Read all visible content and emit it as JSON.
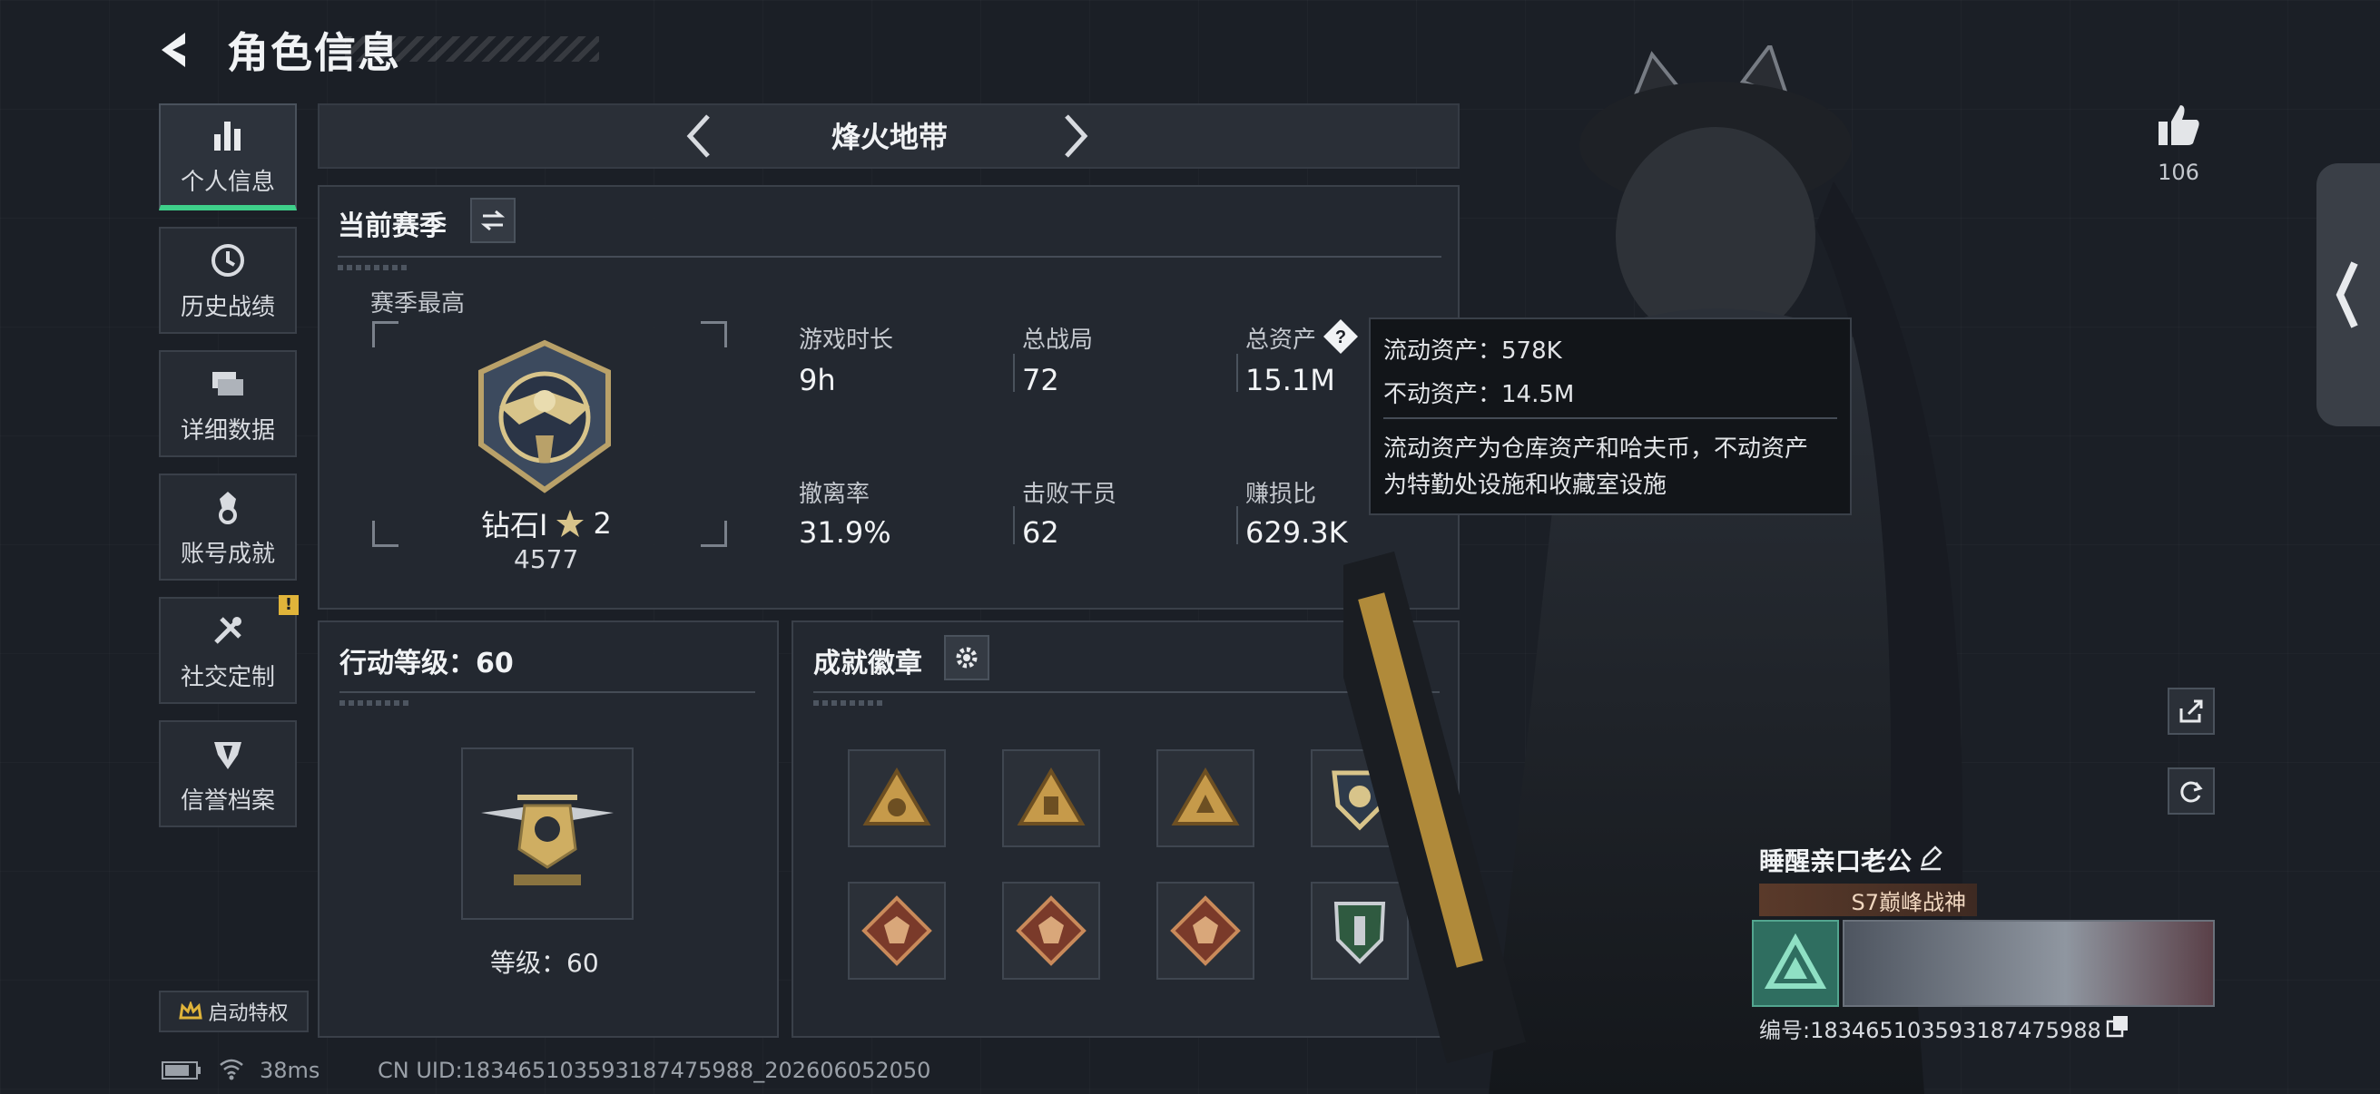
{
  "header": {
    "title": "角色信息"
  },
  "nav": [
    {
      "label": "个人信息",
      "icon": "bar-chart-icon",
      "active": true
    },
    {
      "label": "历史战绩",
      "icon": "clock-icon"
    },
    {
      "label": "详细数据",
      "icon": "layers-icon"
    },
    {
      "label": "账号成就",
      "icon": "medal-icon"
    },
    {
      "label": "社交定制",
      "icon": "tools-icon",
      "badge": "!"
    },
    {
      "label": "信誉档案",
      "icon": "shield-icon"
    }
  ],
  "enable_perk": {
    "label": "启动特权"
  },
  "mode": {
    "title": "烽火地带"
  },
  "season": {
    "title": "当前赛季",
    "best_label": "赛季最高",
    "rank_name": "钻石I",
    "rank_stars": "2",
    "rank_score": "4577",
    "stats": [
      {
        "label": "游戏时长",
        "value": "9h"
      },
      {
        "label": "总战局",
        "value": "72"
      },
      {
        "label": "总资产",
        "value": "15.1M"
      },
      {
        "label": "撤离率",
        "value": "31.9%"
      },
      {
        "label": "击败干员",
        "value": "62"
      },
      {
        "label": "赚损比",
        "value": "629.3K"
      }
    ]
  },
  "tooltip": {
    "liquid": "流动资产：578K",
    "fixed": "不动资产：14.5M",
    "desc_line1": "流动资产为仓库资产和哈夫币，不动资产",
    "desc_line2": "为特勤处设施和收藏室设施"
  },
  "level": {
    "title": "行动等级：60",
    "level_text": "等级：60"
  },
  "badges": {
    "title": "成就徽章",
    "items": [
      "triangle-badge",
      "triangle-badge",
      "triangle-badge",
      "shield-badge",
      "dragon-badge",
      "dragon-badge",
      "dragon-badge",
      "green-shield-badge"
    ]
  },
  "player": {
    "likes": "106",
    "name": "睡醒亲口老公",
    "title_badge": "S7巅峰战神",
    "uid": "编号:1834651035931874759​88"
  },
  "status": {
    "ping": "38ms",
    "uid_line": "CN UID:18346510359318747598​8_202606052050"
  },
  "colors": {
    "accent": "#3ed08a",
    "panel": "#242931",
    "background": "#1b1f26",
    "warning": "#e0b43a"
  }
}
